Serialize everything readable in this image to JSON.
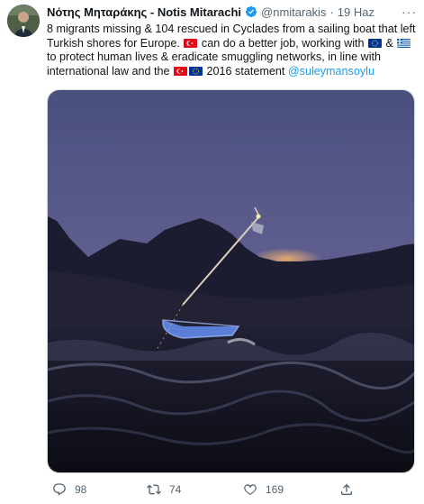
{
  "tweet": {
    "author_name": "Νότης Μηταράκης - Notis Mitarachi",
    "handle": "@nmitarakis",
    "separator": "·",
    "date": "19 Haz",
    "more_label": "···",
    "text": {
      "part1": "8 migrants missing & 104 rescued in Cyclades from a sailing boat that left Turkish shores for Europe.",
      "part2": "can do a better job, working with",
      "part3": "&",
      "part4": "to protect human lives & eradicate smuggling networks, in line with international law and the",
      "part5": "2016  statement",
      "mention": "@suleymansoylu"
    },
    "flags": {
      "turkey": "turkey-flag",
      "eu": "eu-flag",
      "greece": "greece-flag"
    },
    "media": {
      "icon": "photo-sailboat-at-night"
    }
  },
  "actions": {
    "reply_count": "98",
    "retweet_count": "74",
    "like_count": "169"
  },
  "colors": {
    "link": "#1d9bf0",
    "verified": "#1d9bf0",
    "muted": "#536471",
    "text": "#0f1419"
  }
}
